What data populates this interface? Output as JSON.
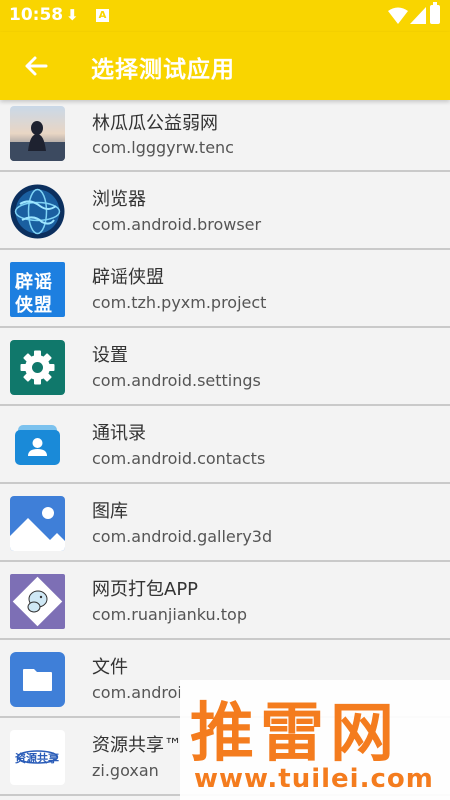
{
  "status_bar": {
    "time": "10:58",
    "icons": [
      "download-icon",
      "a-icon",
      "wifi-icon",
      "signal-icon",
      "battery-icon"
    ]
  },
  "app_bar": {
    "title": "选择测试应用",
    "back_icon": "arrow-back-icon"
  },
  "apps": [
    {
      "name": "林瓜瓜公益弱网",
      "package": "com.lgggyrw.tenc",
      "icon": "photo-girl-icon"
    },
    {
      "name": "浏览器",
      "package": "com.android.browser",
      "icon": "globe-icon"
    },
    {
      "name": "辟谣侠盟",
      "package": "com.tzh.pyxm.project",
      "icon": "piyao-xiameng-icon",
      "icon_text": [
        "辟谣",
        "侠盟"
      ]
    },
    {
      "name": "设置",
      "package": "com.android.settings",
      "icon": "gear-icon"
    },
    {
      "name": "通讯录",
      "package": "com.android.contacts",
      "icon": "contacts-icon"
    },
    {
      "name": "图库",
      "package": "com.android.gallery3d",
      "icon": "gallery-icon"
    },
    {
      "name": "网页打包APP",
      "package": "com.ruanjianku.top",
      "icon": "moomin-icon"
    },
    {
      "name": "文件",
      "package": "com.androi",
      "icon": "folder-icon"
    },
    {
      "name": "资源共享™",
      "package": "zi.goxan",
      "icon": "resource-share-icon",
      "icon_text": "资源共享"
    }
  ],
  "watermark": {
    "text": "推雷网",
    "url": "www.tuilei.com"
  },
  "colors": {
    "accent": "#f9d500",
    "watermark": "#f47c1e",
    "divider": "#c9c9c9"
  }
}
